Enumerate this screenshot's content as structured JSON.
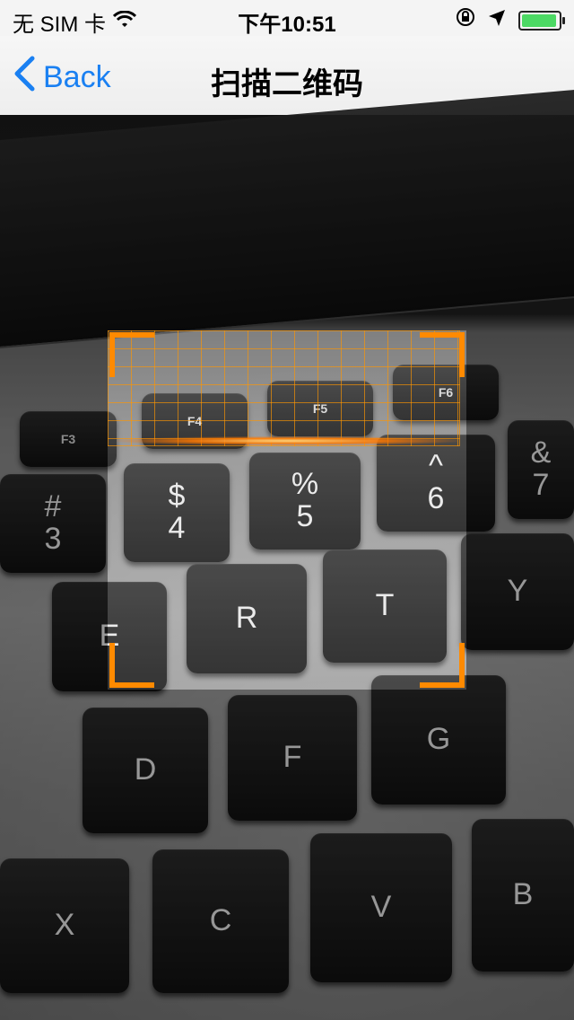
{
  "status_bar": {
    "carrier": "无 SIM 卡",
    "time": "下午10:51",
    "icons": [
      "wifi-icon",
      "orientation-lock-icon",
      "location-arrow-icon",
      "battery-icon"
    ],
    "battery_color": "#4cd964"
  },
  "nav": {
    "back_label": "Back",
    "title": "扫描二维码",
    "accent": "#1a80f2"
  },
  "scanner": {
    "frame_color": "#ff8a00"
  },
  "keyboard": {
    "keys": [
      {
        "top": "",
        "bottom": "F3"
      },
      {
        "top": "",
        "bottom": "F4"
      },
      {
        "top": "",
        "bottom": "F5"
      },
      {
        "top": "",
        "bottom": "F6"
      },
      {
        "top": "#",
        "bottom": "3"
      },
      {
        "top": "$",
        "bottom": "4"
      },
      {
        "top": "%",
        "bottom": "5"
      },
      {
        "top": "^",
        "bottom": "6"
      },
      {
        "top": "&",
        "bottom": "7"
      },
      {
        "top": "E",
        "bottom": ""
      },
      {
        "top": "R",
        "bottom": ""
      },
      {
        "top": "T",
        "bottom": ""
      },
      {
        "top": "Y",
        "bottom": ""
      },
      {
        "top": "D",
        "bottom": ""
      },
      {
        "top": "F",
        "bottom": ""
      },
      {
        "top": "G",
        "bottom": ""
      },
      {
        "top": "X",
        "bottom": ""
      },
      {
        "top": "C",
        "bottom": ""
      },
      {
        "top": "V",
        "bottom": ""
      },
      {
        "top": "B",
        "bottom": ""
      }
    ]
  }
}
